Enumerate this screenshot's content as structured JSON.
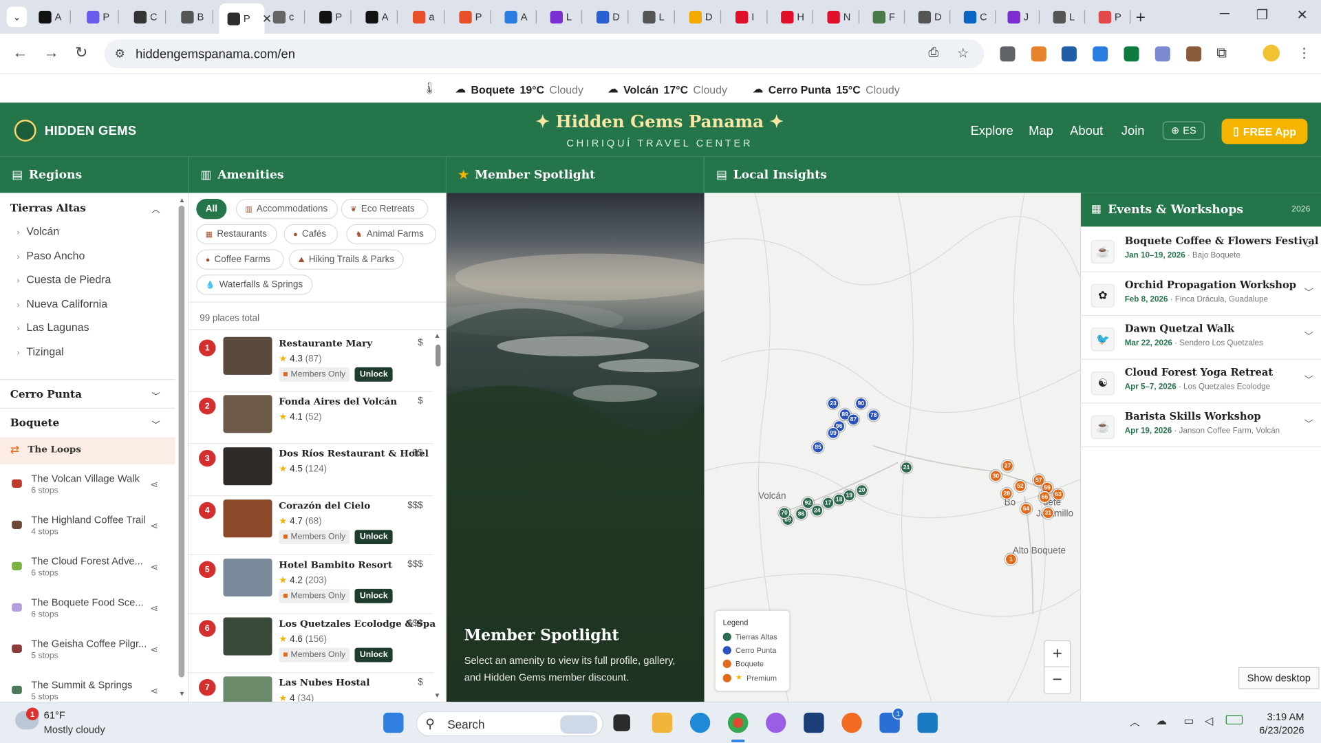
{
  "browser": {
    "tabs": [
      {
        "label": "A",
        "color": "#111111"
      },
      {
        "label": "P",
        "color": "#6b5cf0"
      },
      {
        "label": "C",
        "color": "#333333"
      },
      {
        "label": "B",
        "color": "#555555"
      },
      {
        "label": "P",
        "color": "#ffffff",
        "active": true
      },
      {
        "label": "c",
        "color": "#666666"
      },
      {
        "label": "P",
        "color": "#111111"
      },
      {
        "label": "A",
        "color": "#111111"
      },
      {
        "label": "a",
        "color": "#e8502a"
      },
      {
        "label": "P",
        "color": "#e8502a"
      },
      {
        "label": "A",
        "color": "#2a7de1"
      },
      {
        "label": "L",
        "color": "#7b2fd1"
      },
      {
        "label": "D",
        "color": "#2a5fd1"
      },
      {
        "label": "L",
        "color": "#555555"
      },
      {
        "label": "D",
        "color": "#f2a900"
      },
      {
        "label": "I",
        "color": "#e0102a"
      },
      {
        "label": "H",
        "color": "#e0102a"
      },
      {
        "label": "N",
        "color": "#e0102a"
      },
      {
        "label": "F",
        "color": "#4a7a4a"
      },
      {
        "label": "D",
        "color": "#555555"
      },
      {
        "label": "C",
        "color": "#0a66c2"
      },
      {
        "label": "J",
        "color": "#7b2fd1"
      },
      {
        "label": "L",
        "color": "#555555"
      },
      {
        "label": "P",
        "color": "#e44a4a"
      }
    ],
    "active_close": "✕",
    "new_tab": "+",
    "url": "hiddengemspanama.com/en"
  },
  "weather": [
    {
      "city": "Boquete",
      "temp": "19°C",
      "cond": "Cloudy"
    },
    {
      "city": "Volcán",
      "temp": "17°C",
      "cond": "Cloudy"
    },
    {
      "city": "Cerro Punta",
      "temp": "15°C",
      "cond": "Cloudy"
    }
  ],
  "header": {
    "logo": "HIDDEN GEMS",
    "title": "✦ Hidden Gems Panama ✦",
    "subtitle": "CHIRIQUÍ TRAVEL CENTER",
    "nav": [
      "Explore",
      "Map",
      "About",
      "Join"
    ],
    "lang": "ES",
    "app_button": "FREE App"
  },
  "columns": {
    "regions": "Regions",
    "amenities": "Amenities",
    "spotlight": "Member Spotlight",
    "insights": "Local Insights"
  },
  "regions": {
    "tierras_altas": "Tierras Altas",
    "sub": [
      "Volcán",
      "Paso Ancho",
      "Cuesta de Piedra",
      "Nueva California",
      "Las Lagunas",
      "Tizingal"
    ],
    "cerro_punta": "Cerro Punta",
    "boquete": "Boquete",
    "loops_title": "The Loops",
    "loops": [
      {
        "name": "The Volcan Village Walk",
        "stops": "6 stops",
        "color": "#c0392b"
      },
      {
        "name": "The Highland Coffee Trail",
        "stops": "4 stops",
        "color": "#6b4a3a"
      },
      {
        "name": "The Cloud Forest Adve...",
        "stops": "6 stops",
        "color": "#7cb342"
      },
      {
        "name": "The Boquete Food Sce...",
        "stops": "6 stops",
        "color": "#b39ddb"
      },
      {
        "name": "The Geisha Coffee Pilgr...",
        "stops": "5 stops",
        "color": "#8d3a3a"
      },
      {
        "name": "The Summit & Springs",
        "stops": "5 stops",
        "color": "#4e7a5a"
      }
    ]
  },
  "amenities": {
    "chips": [
      "All",
      "Accommodations",
      "Eco Retreats",
      "Restaurants",
      "Cafés",
      "Animal Farms",
      "Coffee Farms",
      "Hiking Trails & Parks",
      "Waterfalls & Springs"
    ],
    "total": "99 places total",
    "members_only": "Members Only",
    "unlock": "Unlock",
    "places": [
      {
        "num": "1",
        "name": "Restaurante Mary",
        "price": "$",
        "rating": "4.3",
        "count": "(87)",
        "locked": true
      },
      {
        "num": "2",
        "name": "Fonda Aires del Volcán",
        "price": "$",
        "rating": "4.1",
        "count": "(52)",
        "locked": false
      },
      {
        "num": "3",
        "name": "Dos Ríos Restaurant & Hotel",
        "price": "$$",
        "rating": "4.5",
        "count": "(124)",
        "locked": false
      },
      {
        "num": "4",
        "name": "Corazón del Cielo",
        "price": "$$$",
        "rating": "4.7",
        "count": "(68)",
        "locked": true
      },
      {
        "num": "5",
        "name": "Hotel Bambito Resort",
        "price": "$$$",
        "rating": "4.2",
        "count": "(203)",
        "locked": true
      },
      {
        "num": "6",
        "name": "Los Quetzales Ecolodge & Spa",
        "price": "$$$",
        "rating": "4.6",
        "count": "(156)",
        "locked": true
      },
      {
        "num": "7",
        "name": "Las Nubes Hostal",
        "price": "$",
        "rating": "4",
        "count": "(34)",
        "locked": false
      }
    ]
  },
  "spotlight": {
    "title": "Member Spotlight",
    "desc": "Select an amenity to view its full profile, gallery, and Hidden Gems member discount."
  },
  "map": {
    "labels": [
      "Volcán",
      "Bo",
      "uete",
      "Jaramillo",
      "Alto Boquete"
    ],
    "legend_title": "Legend",
    "legend": [
      "Tierras Altas",
      "Cerro Punta",
      "Boquete",
      "Premium"
    ],
    "markers": [
      "23",
      "90",
      "78",
      "89",
      "87",
      "96",
      "99",
      "85",
      "21",
      "20",
      "19",
      "18",
      "17",
      "24",
      "86",
      "92",
      "69",
      "70",
      "30",
      "27",
      "28",
      "52",
      "57",
      "59",
      "66",
      "63",
      "64",
      "31",
      "1"
    ],
    "zoom_in": "+",
    "zoom_out": "−"
  },
  "events": {
    "title": "Events & Workshops",
    "year": "2026",
    "items": [
      {
        "name": "Boquete Coffee & Flowers Festival",
        "date": "Jan 10–19, 2026",
        "place": "· Bajo Boquete",
        "icon": "☕"
      },
      {
        "name": "Orchid Propagation Workshop",
        "date": "Feb 8, 2026",
        "place": "· Finca Drácula, Guadalupe",
        "icon": "✿"
      },
      {
        "name": "Dawn Quetzal Walk",
        "date": "Mar 22, 2026",
        "place": "· Sendero Los Quetzales",
        "icon": "🐦"
      },
      {
        "name": "Cloud Forest Yoga Retreat",
        "date": "Apr 5–7, 2026",
        "place": "· Los Quetzales Ecolodge",
        "icon": "☯"
      },
      {
        "name": "Barista Skills Workshop",
        "date": "Apr 19, 2026",
        "place": "· Janson Coffee Farm, Volcán",
        "icon": "☕"
      }
    ]
  },
  "taskbar": {
    "temp": "61°F",
    "cond": "Mostly cloudy",
    "search": "Search",
    "time": "3:19 AM",
    "date": "6/23/2026",
    "weather_badge": "1",
    "store_badge": "1"
  },
  "show_desktop": "Show desktop"
}
